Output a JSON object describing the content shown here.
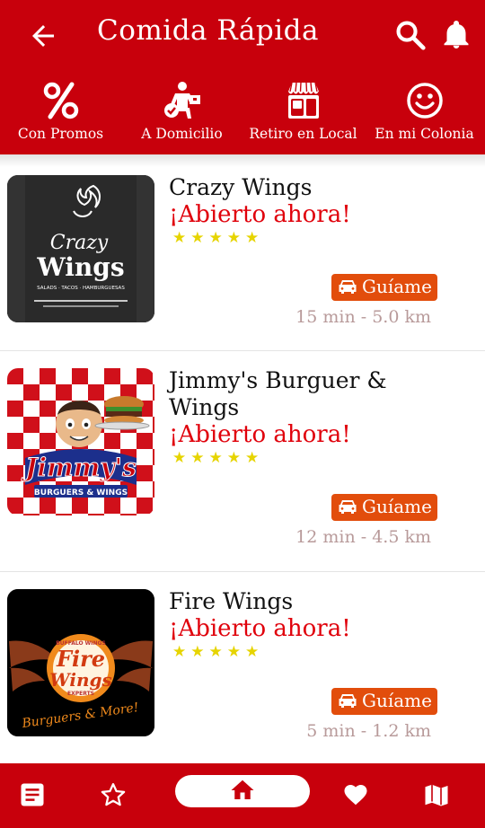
{
  "header": {
    "title": "Comida Rápida",
    "back_icon": "arrow-left-icon",
    "search_icon": "search-icon",
    "notification_icon": "bell-icon"
  },
  "categories": [
    {
      "label": "Con Promos",
      "icon": "percent-icon"
    },
    {
      "label": "A Domicilio",
      "icon": "delivery-icon"
    },
    {
      "label": "Retiro en Local",
      "icon": "storefront-icon"
    },
    {
      "label": "En mi Colonia",
      "icon": "smiley-icon"
    }
  ],
  "restaurants": [
    {
      "name": "Crazy Wings",
      "status": "¡Abierto ahora!",
      "rating_stars": 5,
      "stars": "★★★★★",
      "guide_label": "Guíame",
      "distance": "15 min - 5.0 km",
      "logo_text_1": "Crazy",
      "logo_text_2": "Wings",
      "logo_text_3": "SALADS · TACOS · HAMBURGUESAS"
    },
    {
      "name": "Jimmy's Burguer & Wings",
      "status": "¡Abierto ahora!",
      "rating_stars": 5,
      "stars": "★★★★★",
      "guide_label": "Guíame",
      "distance": "12 min - 4.5 km",
      "logo_text_1": "Jimmy's",
      "logo_text_2": "BURGUERS & WINGS"
    },
    {
      "name": "Fire Wings",
      "status": "¡Abierto ahora!",
      "rating_stars": 5,
      "stars": "★★★★★",
      "guide_label": "Guíame",
      "distance": "5 min - 1.2 km",
      "logo_text_1": "BUFFALO WINGS",
      "logo_text_2": "Fire",
      "logo_text_3": "Wings",
      "logo_text_4": "EXPERTS",
      "logo_text_5": "Burguers & More!"
    }
  ],
  "bottom_nav": [
    {
      "icon": "list-icon"
    },
    {
      "icon": "star-outline-icon"
    },
    {
      "icon": "home-icon",
      "active": true
    },
    {
      "icon": "heart-icon"
    },
    {
      "icon": "map-icon"
    }
  ],
  "colors": {
    "brand_red": "#c8000c",
    "open_red": "#e0000b",
    "guide_orange": "#e24d0c",
    "star_yellow": "#e6d400",
    "distance_grey": "#b89a9a"
  }
}
